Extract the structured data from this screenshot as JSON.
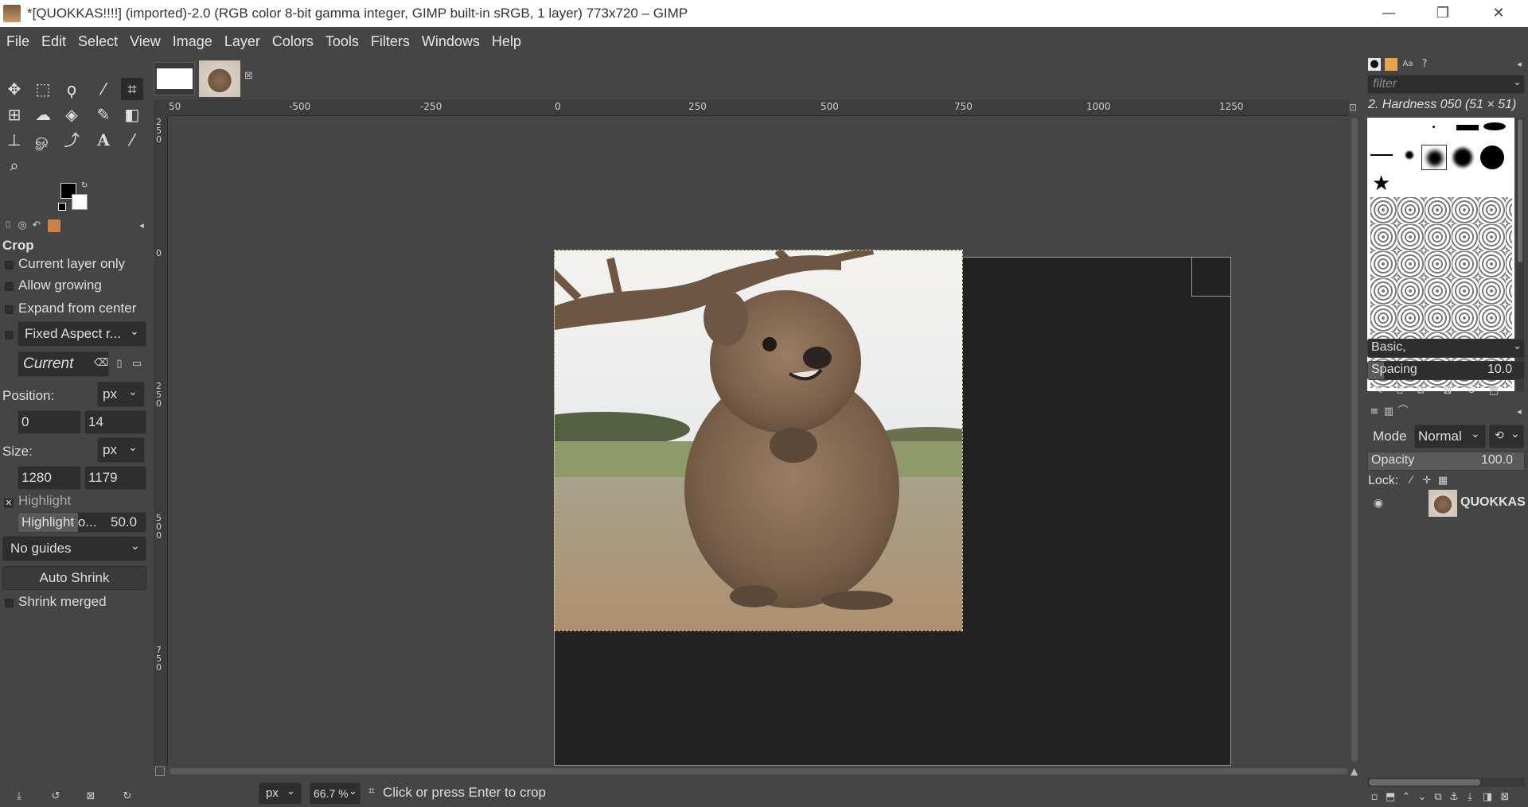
{
  "window": {
    "title": "*[QUOKKAS!!!!] (imported)-2.0 (RGB color 8-bit gamma integer, GIMP built-in sRGB, 1 layer) 773x720 – GIMP",
    "minimize": "—",
    "restore": "❐",
    "close": "✕"
  },
  "menu": [
    "File",
    "Edit",
    "Select",
    "View",
    "Image",
    "Layer",
    "Colors",
    "Tools",
    "Filters",
    "Windows",
    "Help"
  ],
  "tool_options": {
    "title": "Crop",
    "current_layer_only": "Current layer only",
    "allow_growing": "Allow growing",
    "expand_from_center": "Expand from center",
    "fixed_aspect": "Fixed Aspect r...",
    "aspect_value": "Current",
    "position_label": "Position:",
    "position_unit": "px",
    "position_x": "0",
    "position_y": "14",
    "size_label": "Size:",
    "size_unit": "px",
    "size_w": "1280",
    "size_h": "1179",
    "highlight": "Highlight",
    "highlight_opacity_label": "Highlight o...",
    "highlight_opacity_value": "50.0",
    "guides": "No guides",
    "auto_shrink": "Auto Shrink",
    "shrink_merged": "Shrink merged"
  },
  "rulers": {
    "h_ticks": [
      "50",
      "-500",
      "-250",
      "0",
      "250",
      "500",
      "750",
      "1000",
      "1250"
    ],
    "v_ticks": [
      "250",
      "0",
      "250",
      "500",
      "750"
    ]
  },
  "status": {
    "unit": "px",
    "zoom": "66.7 %",
    "message": "Click or press Enter to crop"
  },
  "brushes": {
    "filter_placeholder": "filter",
    "selected": "2. Hardness 050 (51 × 51)",
    "preset": "Basic,",
    "spacing_label": "Spacing",
    "spacing_value": "10.0"
  },
  "layers": {
    "mode_label": "Mode",
    "mode_value": "Normal",
    "opacity_label": "Opacity",
    "opacity_value": "100.0",
    "lock_label": "Lock:",
    "layer_name": "QUOKKAS"
  }
}
